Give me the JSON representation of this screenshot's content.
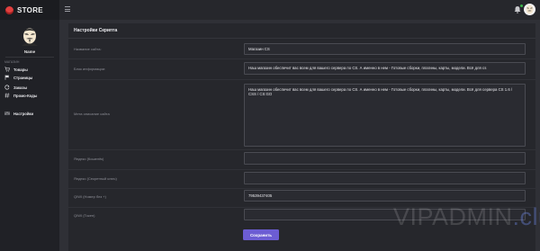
{
  "brand": {
    "name": "STORE"
  },
  "user": {
    "name": "Name"
  },
  "sidebar": {
    "section_label": "МАГАЗИН",
    "items": [
      {
        "label": "Товары",
        "icon": "cart-icon"
      },
      {
        "label": "Страницы",
        "icon": "flag-icon"
      },
      {
        "label": "Заказы",
        "icon": "refresh-icon"
      },
      {
        "label": "Промо-Коды",
        "icon": "tag-icon"
      },
      {
        "label": "Настройки",
        "icon": "settings-icon"
      }
    ]
  },
  "topbar": {
    "menu_icon": "hamburger-icon",
    "notification_icon": "bell-icon",
    "notification_color": "#3bb54a"
  },
  "panel": {
    "title": "Настройки Скрипта",
    "fields": [
      {
        "label": "Название сайта:",
        "value": "Магазин CS"
      },
      {
        "label": "Блок информации:",
        "value": "Наш магазин обеспечит вас всем для вашего сервера по CS. А именно в нем  - Готовые сборки, плагины, карты, модели. Всё для cs"
      },
      {
        "label": "Мета описание сайта",
        "value": "Наш магазин обеспечит вас всем для вашего сервера по CS. А именно в нем  - Готовые сборки, плагины, карты, модели. Всё для сервера CS 1.6 / CSS / CS:GO"
      },
      {
        "label": "Яндекс (Кошелёк)",
        "value": ""
      },
      {
        "label": "Яндекс (Секретный ключ)",
        "value": ""
      },
      {
        "label": "QIWI (Номер без +)",
        "value": "79539437405"
      },
      {
        "label": "QIWI (Токен)",
        "value": ""
      }
    ],
    "save_label": "Сохранить"
  },
  "watermark": {
    "text": "VIPADMIN",
    "dot": ".club"
  },
  "colors": {
    "accent": "#6c5dd3",
    "brand": "#e2403f"
  }
}
